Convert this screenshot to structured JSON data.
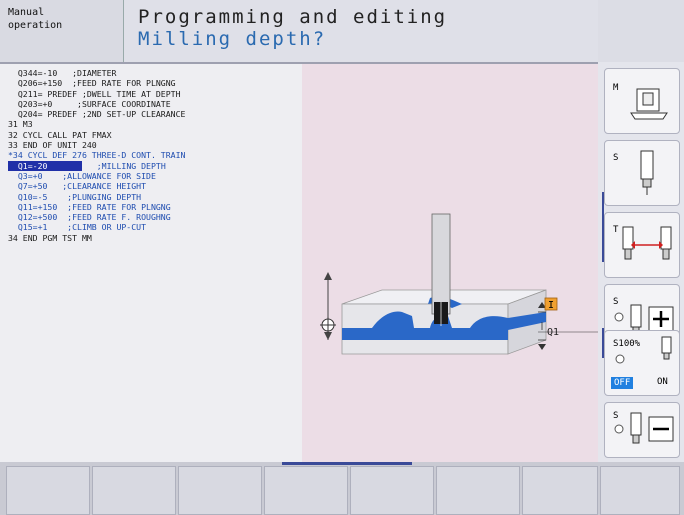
{
  "header": {
    "mode_line1": "Manual",
    "mode_line2": "operation",
    "title": "Programming and editing",
    "subtitle": "Milling depth?"
  },
  "program_lines": [
    {
      "text": "  Q344=-10   ;DIAMETER",
      "color": "black"
    },
    {
      "text": "  Q206=+150  ;FEED RATE FOR PLNGNG",
      "color": "black"
    },
    {
      "text": "  Q211= PREDEF ;DWELL TIME AT DEPTH",
      "color": "black"
    },
    {
      "text": "  Q203=+0     ;SURFACE COORDINATE",
      "color": "black"
    },
    {
      "text": "  Q204= PREDEF ;2ND SET-UP CLEARANCE",
      "color": "black"
    },
    {
      "text": "31 M3",
      "color": "black"
    },
    {
      "text": "32 CYCL CALL PAT FMAX",
      "color": "black"
    },
    {
      "text": "33 END OF UNIT 240",
      "color": "black"
    },
    {
      "text": "*34 CYCL DEF 276 THREE-D CONT. TRAIN",
      "color": "blue"
    },
    {
      "text": "  Q1=-20",
      "hl_tail": "   ;MILLING DEPTH",
      "color": "blue"
    },
    {
      "text": "  Q3=+0    ;ALLOWANCE FOR SIDE",
      "color": "blue"
    },
    {
      "text": "  Q7=+50   ;CLEARANCE HEIGHT",
      "color": "blue"
    },
    {
      "text": "  Q10=-5    ;PLUNGING DEPTH",
      "color": "blue"
    },
    {
      "text": "  Q11=+150  ;FEED RATE FOR PLNGNG",
      "color": "blue"
    },
    {
      "text": "  Q12=+500  ;FEED RATE F. ROUGHNG",
      "color": "blue"
    },
    {
      "text": "  Q15=+1    ;CLIMB OR UP-CUT",
      "color": "blue"
    },
    {
      "text": "34 END PGM TST MM",
      "color": "black"
    }
  ],
  "graphic": {
    "q_label": "Q1",
    "marker": "I"
  },
  "softkeys": {
    "m_label": "M",
    "s_label": "S",
    "t_label": "T",
    "s_plus_label": "S",
    "s100_label": "S100%",
    "off_label": "OFF",
    "on_label": "ON",
    "s_minus_label": "S"
  },
  "colors": {
    "program_blue": "#1f4db0",
    "highlight": "#2030a8",
    "graphic_bg": "#ecdde6",
    "surface_blue": "#2a68c8",
    "marker_orange": "#f0a030"
  }
}
